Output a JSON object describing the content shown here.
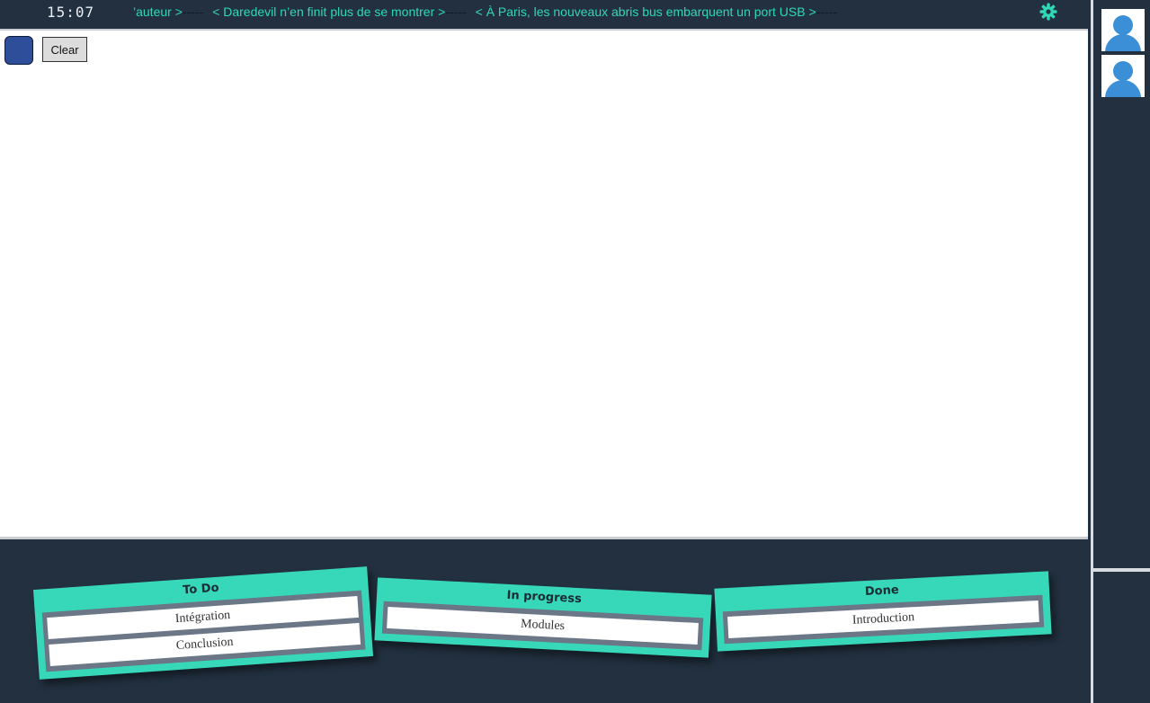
{
  "topbar": {
    "clock": "15:07",
    "ticker": [
      {
        "text": "’auteur >",
        "sep": "-----"
      },
      {
        "text": "< Daredevil n’en finit plus de se montrer >",
        "sep": "-----"
      },
      {
        "text": "< À Paris, les nouveaux abris bus embarquent un port USB >",
        "sep": "-----"
      }
    ],
    "settings_icon": "gear-icon"
  },
  "toolbar": {
    "color": "#2f4e9a",
    "clear_label": "Clear"
  },
  "sidebar": {
    "avatars": [
      "user-avatar-icon",
      "user-avatar-icon"
    ]
  },
  "kanban": {
    "columns": [
      {
        "title": "To Do",
        "cards": [
          "Intégration",
          "Conclusion"
        ]
      },
      {
        "title": "In progress",
        "cards": [
          "Modules"
        ]
      },
      {
        "title": "Done",
        "cards": [
          "Introduction"
        ]
      }
    ]
  },
  "colors": {
    "background": "#22303f",
    "accent": "#36d8b9",
    "card_well": "#6b7786"
  }
}
